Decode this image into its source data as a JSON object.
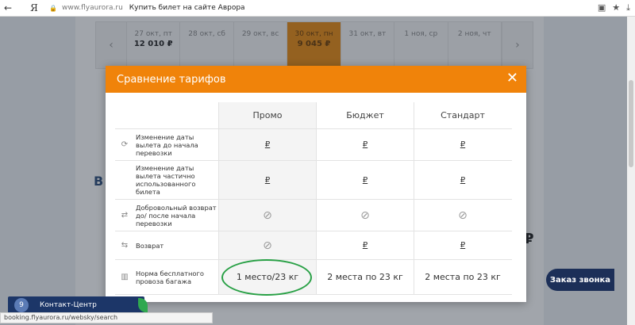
{
  "browser": {
    "back_icon": "arrow-left-icon",
    "back_glyph": "←",
    "yandex_glyph": "Я",
    "lock_glyph": "🔒",
    "domain": "www.flyaurora.ru",
    "page_title": "Купить билет на сайте Аврора",
    "extension_glyph": "▣",
    "star_glyph": "★",
    "download_glyph": "⤓"
  },
  "date_bar": {
    "prev_glyph": "‹",
    "next_glyph": "›",
    "dates": [
      {
        "day": "27 окт, пт",
        "price": "12 010 ₽",
        "active": false
      },
      {
        "day": "28 окт, сб",
        "price": "",
        "active": false
      },
      {
        "day": "29 окт, вс",
        "price": "",
        "active": false
      },
      {
        "day": "30 окт, пн",
        "price": "9 045 ₽",
        "active": true
      },
      {
        "day": "31 окт, вт",
        "price": "",
        "active": false
      },
      {
        "day": "1 ноя, ср",
        "price": "",
        "active": false
      },
      {
        "day": "2 ноя, чт",
        "price": "",
        "active": false
      }
    ]
  },
  "background": {
    "side_letter": "В",
    "side_price": "₽"
  },
  "modal": {
    "title": "Сравнение тарифов",
    "close_glyph": "✕",
    "columns": [
      "Промо",
      "Бюджет",
      "Стандарт"
    ],
    "rows": [
      {
        "icon": "refresh-icon",
        "icon_glyph": "⟳",
        "label": "Изменение даты вылета до начала перевозки",
        "values": [
          "₽",
          "₽",
          "₽"
        ],
        "type": "rub"
      },
      {
        "icon": "none",
        "icon_glyph": "",
        "label": "Изменение даты вылета частично использованного билета",
        "values": [
          "₽",
          "₽",
          "₽"
        ],
        "type": "rub"
      },
      {
        "icon": "refund-icon",
        "icon_glyph": "⇄",
        "label": "Добровольный возврат до/ после начала перевозки",
        "values": [
          "⊘",
          "⊘",
          "⊘"
        ],
        "type": "ban"
      },
      {
        "icon": "return-icon",
        "icon_glyph": "⇆",
        "label": "Возврат",
        "values": [
          "⊘",
          "₽",
          "₽"
        ],
        "type": "mixed"
      },
      {
        "icon": "baggage-icon",
        "icon_glyph": "▥",
        "label": "Норма бесплатного провоза багажа",
        "values": [
          "1 место/23 кг",
          "2 места по 23 кг",
          "2 места по 23 кг"
        ],
        "type": "text"
      }
    ]
  },
  "callback_label": "Заказ звонка",
  "contact_center": {
    "label": "Контакт-Центр",
    "avatar_glyph": "9"
  },
  "status_url": "booking.flyaurora.ru/websky/search",
  "colors": {
    "accent_orange": "#f0830a",
    "highlight_green": "#28a045",
    "navy": "#1c2f58"
  }
}
